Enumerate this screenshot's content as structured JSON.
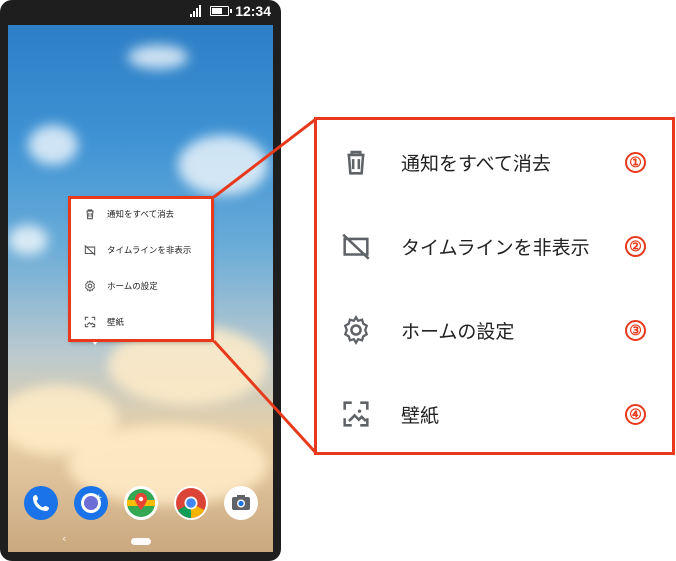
{
  "status_bar": {
    "time": "12:34",
    "signal_icon": "signal-icon",
    "battery_icon": "battery-icon"
  },
  "menu": {
    "items": [
      {
        "label": "通知をすべて消去",
        "icon": "trash-icon",
        "badge": "①"
      },
      {
        "label": "タイムラインを非表示",
        "icon": "timeline-hide-icon",
        "badge": "②"
      },
      {
        "label": "ホームの設定",
        "icon": "gear-icon",
        "badge": "③"
      },
      {
        "label": "壁紙",
        "icon": "wallpaper-icon",
        "badge": "④"
      }
    ]
  },
  "dock": {
    "apps": [
      "phone-icon",
      "messages-icon",
      "maps-icon",
      "chrome-icon",
      "camera-icon"
    ]
  },
  "colors": {
    "highlight": "#e8391c",
    "sky": "#3f93d4"
  }
}
